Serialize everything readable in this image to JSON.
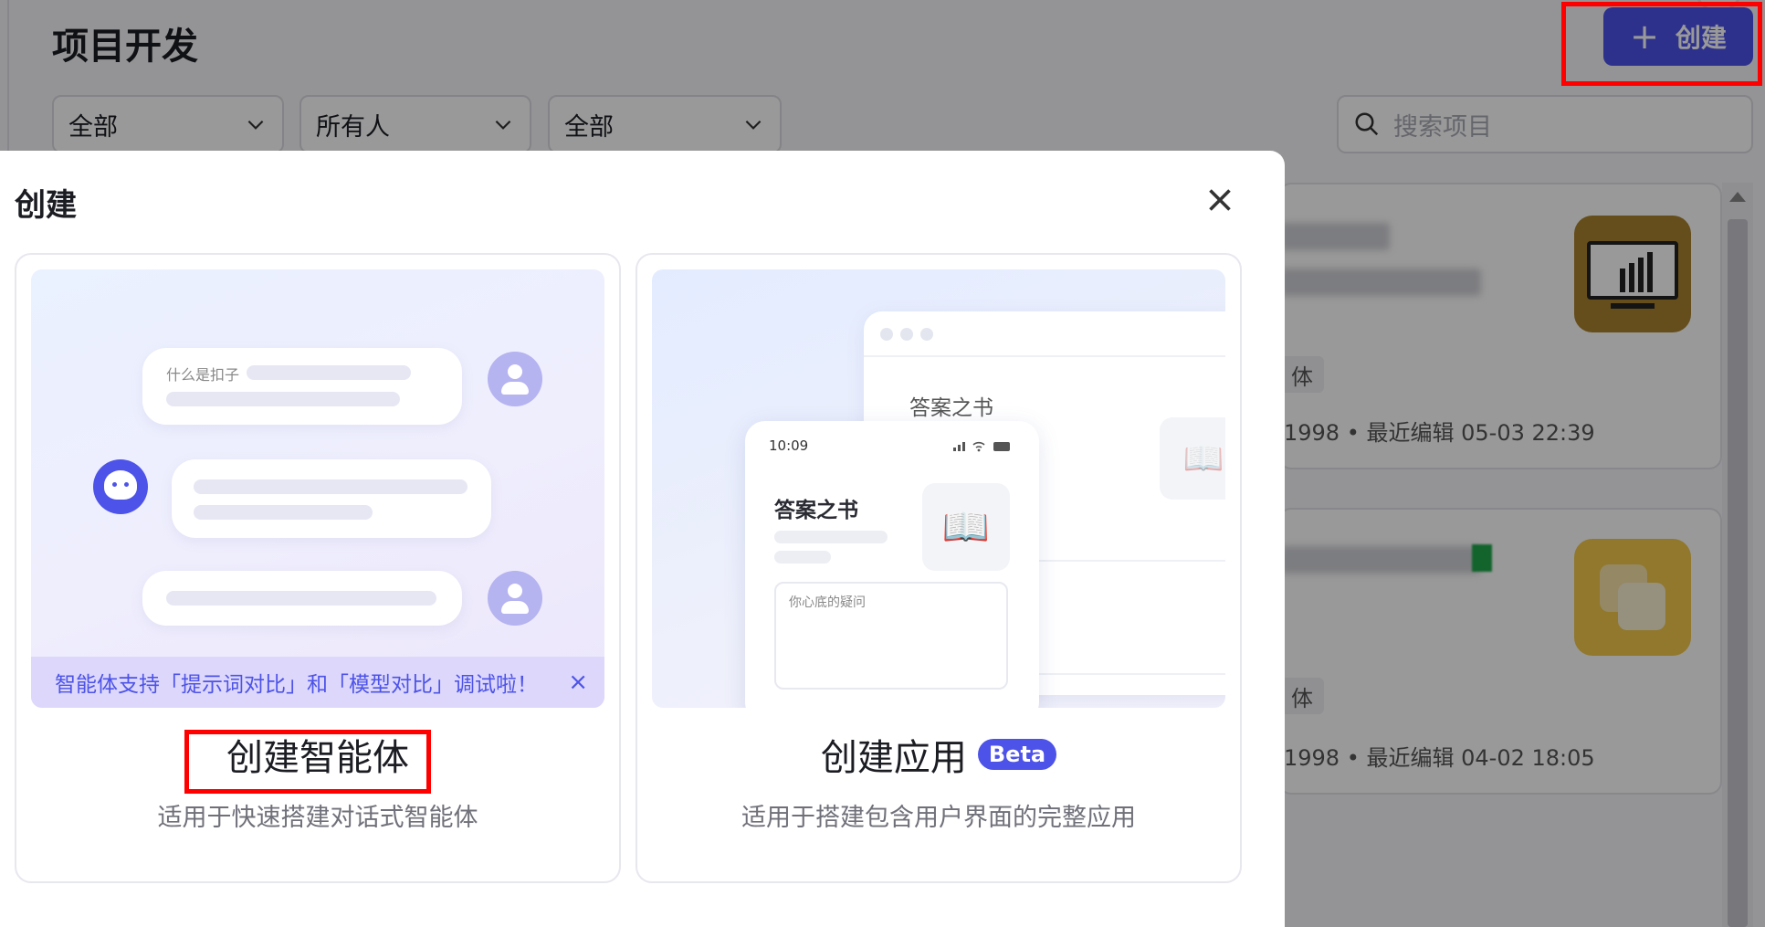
{
  "page": {
    "title": "项目开发",
    "create_button": "创建",
    "filters": [
      "全部",
      "所有人",
      "全部"
    ],
    "search_placeholder": "搜索项目"
  },
  "projects": [
    {
      "tag": "体",
      "meta": "1998 • 最近编辑 05-03 22:39"
    },
    {
      "tag": "体",
      "meta": "1998 • 最近编辑 04-02 18:05"
    }
  ],
  "modal": {
    "title": "创建",
    "agent": {
      "title": "创建智能体",
      "description": "适用于快速搭建对话式智能体",
      "preview_question": "什么是扣子",
      "banner": "智能体支持「提示词对比」和「模型对比」调试啦！"
    },
    "app": {
      "title": "创建应用",
      "badge": "Beta",
      "description": "适用于搭建包含用户界面的完整应用",
      "preview_time": "10:09",
      "preview_app_name": "答案之书",
      "preview_input_placeholder": "你心底的疑问"
    }
  },
  "colors": {
    "brand": "#4d53e8",
    "highlight": "#ff0000"
  }
}
